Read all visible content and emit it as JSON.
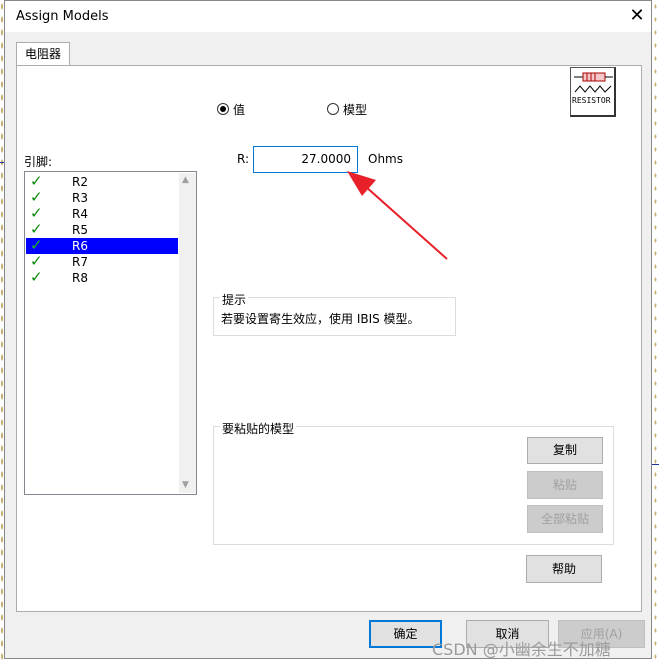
{
  "window": {
    "title": "Assign Models"
  },
  "tabs": [
    {
      "label": "电阻器"
    }
  ],
  "mode": {
    "value_label": "值",
    "model_label": "模型",
    "selected": "value"
  },
  "symbol": {
    "label": "RESISTOR"
  },
  "pins": {
    "label": "引脚:",
    "items": [
      {
        "label": "R2",
        "checked": true
      },
      {
        "label": "R3",
        "checked": true
      },
      {
        "label": "R4",
        "checked": true
      },
      {
        "label": "R5",
        "checked": true
      },
      {
        "label": "R6",
        "checked": true,
        "selected": true
      },
      {
        "label": "R7",
        "checked": true
      },
      {
        "label": "R8",
        "checked": true
      }
    ]
  },
  "resistance": {
    "label": "R:",
    "value": "27.0000",
    "unit": "Ohms"
  },
  "hint": {
    "title": "提示",
    "text": "若要设置寄生效应，使用 IBIS 模型。"
  },
  "paste_group": {
    "title": "要粘贴的模型",
    "copy": "复制",
    "paste": "粘贴",
    "paste_all": "全部粘贴"
  },
  "help_button": "帮助",
  "footer": {
    "ok": "确定",
    "cancel": "取消",
    "apply": "应用(A)"
  },
  "watermark": "CSDN @小幽余生不加糖",
  "colors": {
    "selection": "#0000ff",
    "check": "#0a8a0a",
    "annotation_arrow": "#e8202a",
    "focus": "#0078d7"
  }
}
